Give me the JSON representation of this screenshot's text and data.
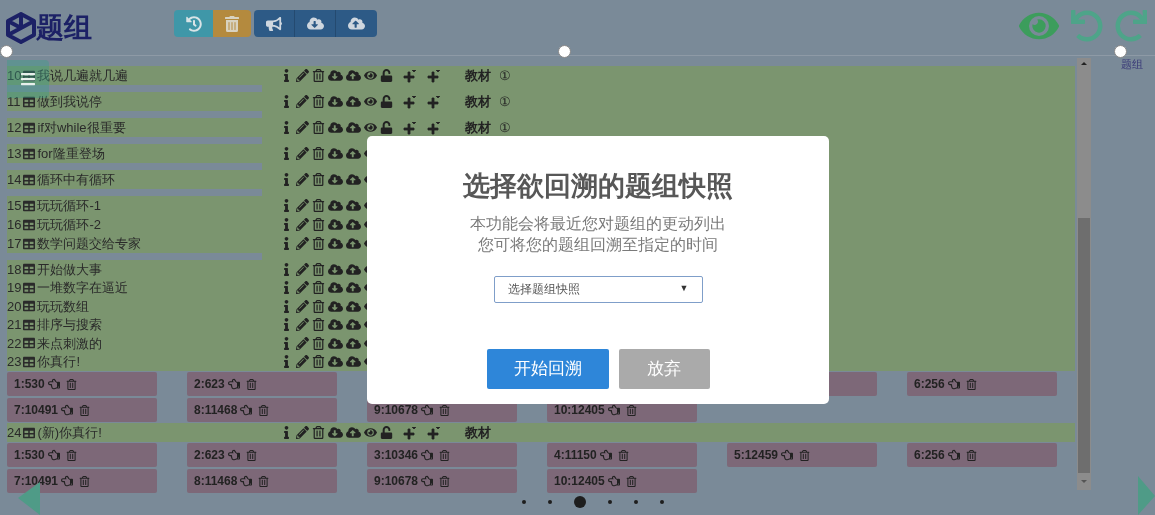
{
  "header": {
    "logo": "题组"
  },
  "side_label": "题组",
  "groups": [
    {
      "rows": [
        {
          "number": "10",
          "title": "我说几遍就几遍",
          "tag": "教材",
          "badge": "①"
        }
      ]
    },
    {
      "rows": [
        {
          "number": "11",
          "title": "做到我说停",
          "tag": "教材",
          "badge": "①"
        }
      ]
    },
    {
      "rows": [
        {
          "number": "12",
          "title": "if对while很重要",
          "tag": "教材",
          "badge": "①"
        }
      ]
    },
    {
      "rows": [
        {
          "number": "13",
          "title": "for隆重登场"
        }
      ]
    },
    {
      "rows": [
        {
          "number": "14",
          "title": "循环中有循环"
        }
      ]
    },
    {
      "rows": [
        {
          "number": "15",
          "title": "玩玩循环-1"
        },
        {
          "number": "16",
          "title": "玩玩循环-2"
        },
        {
          "number": "17",
          "title": "数学问题交给专家"
        }
      ]
    },
    {
      "rows": [
        {
          "number": "18",
          "title": "开始做大事"
        },
        {
          "number": "19",
          "title": "一堆数字在逼近"
        },
        {
          "number": "20",
          "title": "玩玩数组"
        },
        {
          "number": "21",
          "title": "排序与搜索"
        },
        {
          "number": "22",
          "title": "来点刺激的"
        },
        {
          "number": "23",
          "title": "你真行!"
        }
      ],
      "snapshots": [
        {
          "label": "1:530"
        },
        {
          "label": "2:623"
        },
        {
          "kind": "gap"
        },
        {
          "kind": "gap"
        },
        {
          "kind": "covered"
        },
        {
          "label": "6:256"
        },
        {
          "label": "7:10491"
        },
        {
          "label": "8:11468"
        },
        {
          "label": "9:10678"
        },
        {
          "label": "10:12405"
        }
      ]
    },
    {
      "rows": [
        {
          "number": "24",
          "title": "(新)你真行!",
          "tag": "教材"
        }
      ],
      "snapshots": [
        {
          "label": "1:530"
        },
        {
          "label": "2:623"
        },
        {
          "label": "3:10346"
        },
        {
          "label": "4:11150"
        },
        {
          "label": "5:12459"
        },
        {
          "label": "6:256"
        },
        {
          "label": "7:10491"
        },
        {
          "label": "8:11468"
        },
        {
          "label": "9:10678"
        },
        {
          "label": "10:12405"
        }
      ]
    }
  ],
  "pagination": [
    {
      "selected": false
    },
    {
      "selected": false
    },
    {
      "selected": true
    },
    {
      "selected": false
    },
    {
      "selected": false
    },
    {
      "selected": false
    }
  ],
  "dialog": {
    "title": "选择欲回溯的题组快照",
    "lines": [
      "本功能会将最近您对题组的更动列出",
      "您可将您的题组回溯至指定的时间"
    ],
    "select": {
      "placeholder": "选择题组快照",
      "caret": "▼"
    },
    "buttons": [
      {
        "kind": "primary",
        "label": "开始回溯"
      },
      {
        "kind": "secondary",
        "label": "放弃"
      }
    ]
  }
}
